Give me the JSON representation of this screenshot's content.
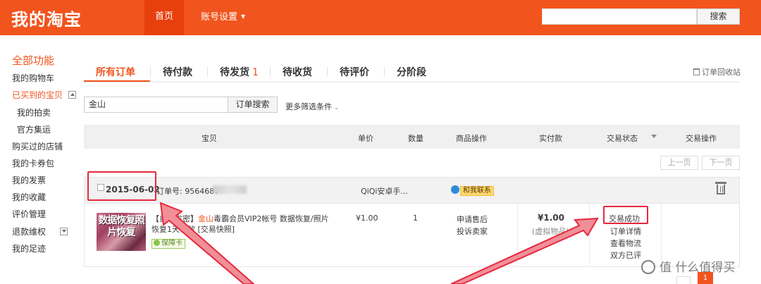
{
  "header": {
    "logo": "我的淘宝",
    "nav_home": "首页",
    "nav_account": "账号设置",
    "search_button": "搜索"
  },
  "sidebar": {
    "title": "全部功能",
    "items": [
      {
        "label": "我的购物车"
      },
      {
        "label": "已买到的宝贝"
      },
      {
        "label": "我的拍卖"
      },
      {
        "label": "官方集运"
      },
      {
        "label": "购买过的店铺"
      },
      {
        "label": "我的卡券包"
      },
      {
        "label": "我的发票"
      },
      {
        "label": "我的收藏"
      },
      {
        "label": "评价管理"
      },
      {
        "label": "退款维权"
      },
      {
        "label": "我的足迹"
      }
    ]
  },
  "tabs": [
    {
      "label": "所有订单"
    },
    {
      "label": "待付款"
    },
    {
      "label": "待发货",
      "count": "1"
    },
    {
      "label": "待收货"
    },
    {
      "label": "待评价"
    },
    {
      "label": "分阶段"
    }
  ],
  "recycle_bin": "订单回收站",
  "order_search": {
    "value": "金山",
    "button": "订单搜索",
    "more_filters": "更多筛选条件"
  },
  "table_header": {
    "item": "宝贝",
    "unit_price": "单价",
    "quantity": "数量",
    "item_ops": "商品操作",
    "paid": "实付款",
    "status": "交易状态",
    "ops": "交易操作"
  },
  "pager": {
    "prev": "上一页",
    "next": "下一页",
    "current": "1"
  },
  "order": {
    "date": "2015-06-02",
    "order_no_prefix": "订单号: 9564687",
    "shop": "QiQi安卓手...",
    "contact_label": "和我联系",
    "thumb_text": "数据恢复照片恢复",
    "title_prefix": "【自动发密】",
    "title_highlight": "金山",
    "title_rest": "毒霸会员VIP2帐号 数据恢复/照片恢复1天有效 [交易快照]",
    "warranty": "保障卡",
    "unit_price": "¥1.00",
    "quantity": "1",
    "item_op_1": "申请售后",
    "item_op_2": "投诉卖家",
    "paid": "¥1.00",
    "paid_note": "(虚拟物品)",
    "status": "交易成功",
    "status_links": [
      "订单详情",
      "查看物流",
      "双方已评"
    ]
  },
  "watermark": "值 什么值得买",
  "colors": {
    "brand": "#f2541d",
    "highlight": "#e6283c"
  }
}
